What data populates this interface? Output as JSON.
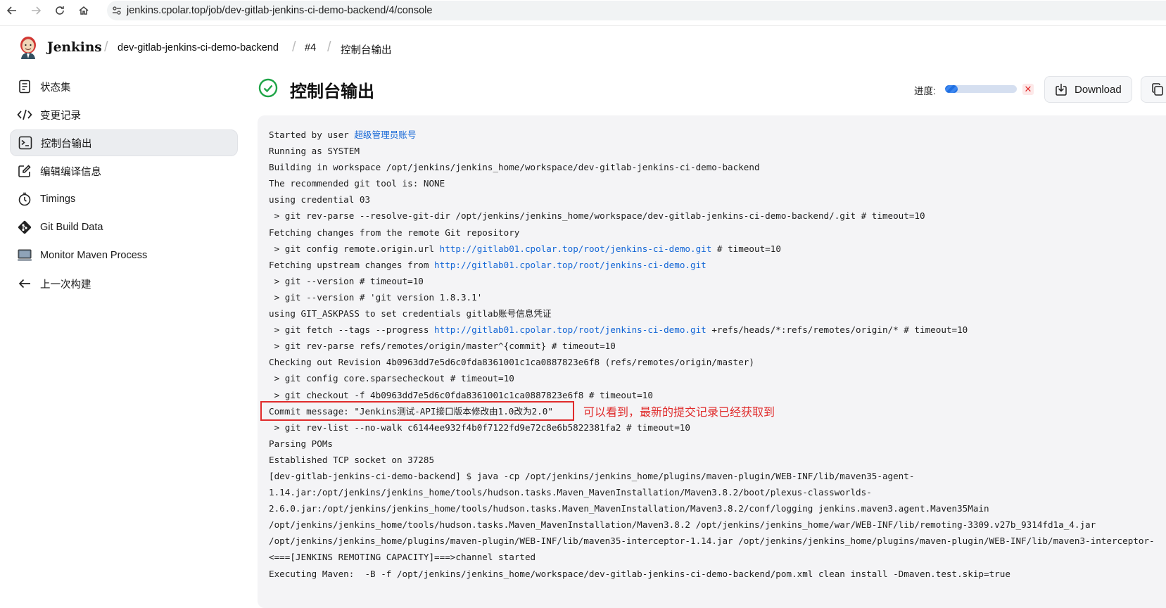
{
  "browser": {
    "url": "jenkins.cpolar.top/job/dev-gitlab-jenkins-ci-demo-backend/4/console",
    "back_icon": "arrow-left-icon",
    "forward_icon": "arrow-right-icon",
    "reload_icon": "reload-icon",
    "home_icon": "home-icon",
    "site_info_icon": "tune-icon"
  },
  "header": {
    "brand": "Jenkins",
    "breadcrumbs": [
      "dev-gitlab-jenkins-ci-demo-backend",
      "#4",
      "控制台输出"
    ]
  },
  "sidebar": {
    "items": [
      {
        "label": "状态集",
        "icon": "document-icon"
      },
      {
        "label": "变更记录",
        "icon": "code-icon"
      },
      {
        "label": "控制台输出",
        "icon": "terminal-icon",
        "active": true
      },
      {
        "label": "编辑编译信息",
        "icon": "edit-icon"
      },
      {
        "label": "Timings",
        "icon": "stopwatch-icon"
      },
      {
        "label": "Git Build Data",
        "icon": "git-icon"
      },
      {
        "label": "Monitor Maven Process",
        "icon": "monitor-icon"
      },
      {
        "label": "上一次构建",
        "icon": "arrow-left-icon"
      }
    ]
  },
  "main": {
    "title": "控制台输出",
    "status_icon": "success-check-icon",
    "progress_label": "进度:",
    "progress_value": 0.18,
    "download_label": "Download",
    "copy_icon": "copy-icon"
  },
  "console": {
    "lines": [
      {
        "text": "Started by user ",
        "link": "超级管理员账号",
        "tail": ""
      },
      {
        "text": "Running as SYSTEM"
      },
      {
        "text": "Building in workspace /opt/jenkins/jenkins_home/workspace/dev-gitlab-jenkins-ci-demo-backend"
      },
      {
        "text": "The recommended git tool is: NONE"
      },
      {
        "text": "using credential 03"
      },
      {
        "text": " > git rev-parse --resolve-git-dir /opt/jenkins/jenkins_home/workspace/dev-gitlab-jenkins-ci-demo-backend/.git # timeout=10"
      },
      {
        "text": "Fetching changes from the remote Git repository"
      },
      {
        "text": " > git config remote.origin.url ",
        "link": "http://gitlab01.cpolar.top/root/jenkins-ci-demo.git",
        "tail": " # timeout=10"
      },
      {
        "text": "Fetching upstream changes from ",
        "link": "http://gitlab01.cpolar.top/root/jenkins-ci-demo.git",
        "tail": ""
      },
      {
        "text": " > git --version # timeout=10"
      },
      {
        "text": " > git --version # 'git version 1.8.3.1'"
      },
      {
        "text": "using GIT_ASKPASS to set credentials gitlab账号信息凭证"
      },
      {
        "text": " > git fetch --tags --progress ",
        "link": "http://gitlab01.cpolar.top/root/jenkins-ci-demo.git",
        "tail": " +refs/heads/*:refs/remotes/origin/* # timeout=10"
      },
      {
        "text": " > git rev-parse refs/remotes/origin/master^{commit} # timeout=10"
      },
      {
        "text": "Checking out Revision 4b0963dd7e5d6c0fda8361001c1ca0887823e6f8 (refs/remotes/origin/master)"
      },
      {
        "text": " > git config core.sparsecheckout # timeout=10"
      },
      {
        "text": " > git checkout -f 4b0963dd7e5d6c0fda8361001c1ca0887823e6f8 # timeout=10"
      },
      {
        "text": "Commit message: \"Jenkins测试-API接口版本修改由1.0改为2.0\""
      },
      {
        "text": " > git rev-list --no-walk c6144ee932f4b0f7122fd9e72c8e6b5822381fa2 # timeout=10"
      },
      {
        "text": "Parsing POMs"
      },
      {
        "text": "Established TCP socket on 37285"
      },
      {
        "text": "[dev-gitlab-jenkins-ci-demo-backend] $ java -cp /opt/jenkins/jenkins_home/plugins/maven-plugin/WEB-INF/lib/maven35-agent-"
      },
      {
        "text": "1.14.jar:/opt/jenkins/jenkins_home/tools/hudson.tasks.Maven_MavenInstallation/Maven3.8.2/boot/plexus-classworlds-"
      },
      {
        "text": "2.6.0.jar:/opt/jenkins/jenkins_home/tools/hudson.tasks.Maven_MavenInstallation/Maven3.8.2/conf/logging jenkins.maven3.agent.Maven35Main"
      },
      {
        "text": "/opt/jenkins/jenkins_home/tools/hudson.tasks.Maven_MavenInstallation/Maven3.8.2 /opt/jenkins/jenkins_home/war/WEB-INF/lib/remoting-3309.v27b_9314fd1a_4.jar"
      },
      {
        "text": "/opt/jenkins/jenkins_home/plugins/maven-plugin/WEB-INF/lib/maven35-interceptor-1.14.jar /opt/jenkins/jenkins_home/plugins/maven-plugin/WEB-INF/lib/maven3-interceptor-"
      },
      {
        "text": "<===[JENKINS REMOTING CAPACITY]===>channel started"
      },
      {
        "text": "Executing Maven:  -B -f /opt/jenkins/jenkins_home/workspace/dev-gitlab-jenkins-ci-demo-backend/pom.xml clean install -Dmaven.test.skip=true"
      }
    ],
    "annotation": "可以看到，最新的提交记录已经获取到",
    "highlight_color": "#e02b2b",
    "link_color": "#1366d6"
  }
}
